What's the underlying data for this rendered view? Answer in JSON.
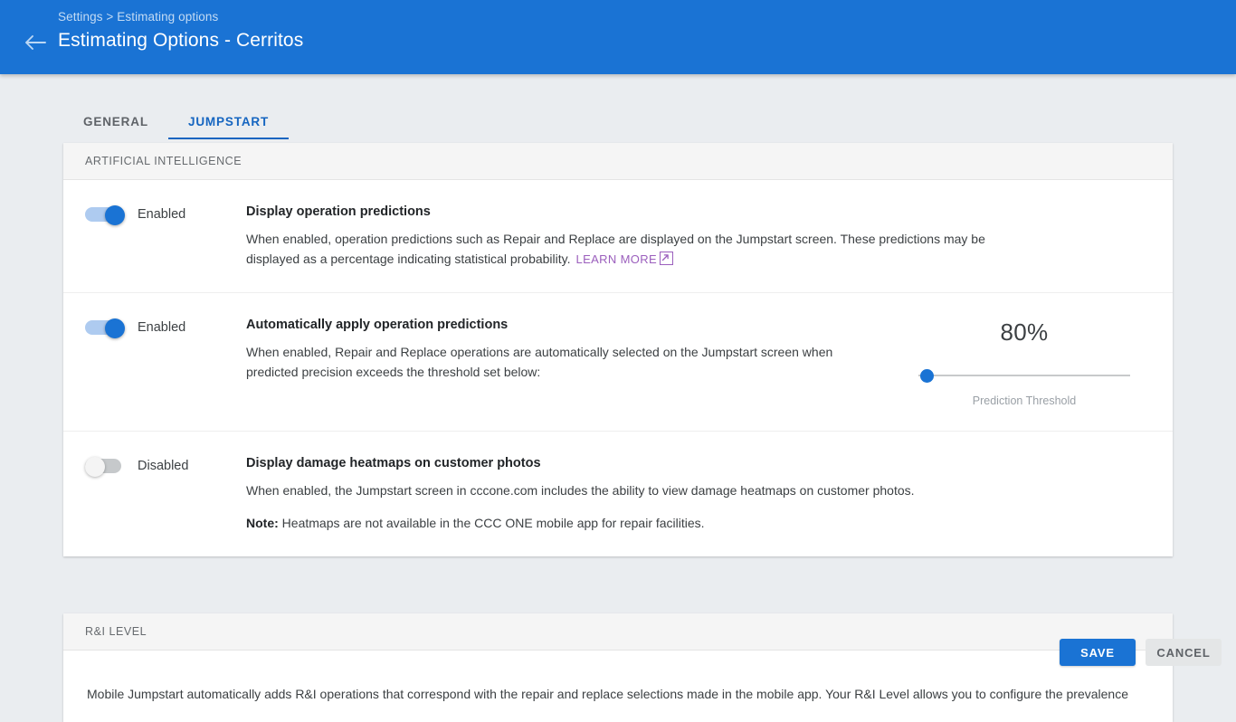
{
  "appbar": {
    "breadcrumb": "Settings > Estimating options",
    "title": "Estimating Options - Cerritos",
    "back_icon": "arrow-left-icon",
    "accent_color": "#1a73d4"
  },
  "tabs": [
    {
      "label": "GENERAL",
      "active": false
    },
    {
      "label": "JUMPSTART",
      "active": true
    }
  ],
  "sections": [
    {
      "header": "ARTIFICIAL INTELLIGENCE",
      "rows": [
        {
          "toggle_state": "on",
          "toggle_label": "Enabled",
          "title": "Display operation predictions",
          "desc": "When enabled, operation predictions such as Repair and Replace are displayed on the Jumpstart screen. These predictions may be displayed as a percentage indicating statistical probability.",
          "link_label": "LEARN MORE",
          "link_color": "#9b5fbd"
        },
        {
          "toggle_state": "on",
          "toggle_label": "Enabled",
          "title": "Automatically apply operation predictions",
          "desc": "When enabled, Repair and Replace operations are automatically selected on the Jumpstart screen when predicted precision exceeds the threshold set below:",
          "slider": {
            "value_label": "80%",
            "caption": "Prediction Threshold",
            "thumb_position_percent": 1
          }
        },
        {
          "toggle_state": "off",
          "toggle_label": "Disabled",
          "title": "Display damage heatmaps on customer photos",
          "desc": "When enabled, the Jumpstart screen in cccone.com includes the ability to view damage heatmaps on customer photos.",
          "note_prefix": "Note:",
          "note_body": " Heatmaps are not available in the CCC ONE mobile app for repair facilities."
        }
      ]
    },
    {
      "header": "R&I LEVEL",
      "body_text": "Mobile Jumpstart automatically adds R&I operations that correspond with the repair and replace selections made in the mobile app. Your R&I Level allows you to configure the prevalence"
    }
  ],
  "footer": {
    "save_label": "SAVE",
    "cancel_label": "CANCEL"
  }
}
